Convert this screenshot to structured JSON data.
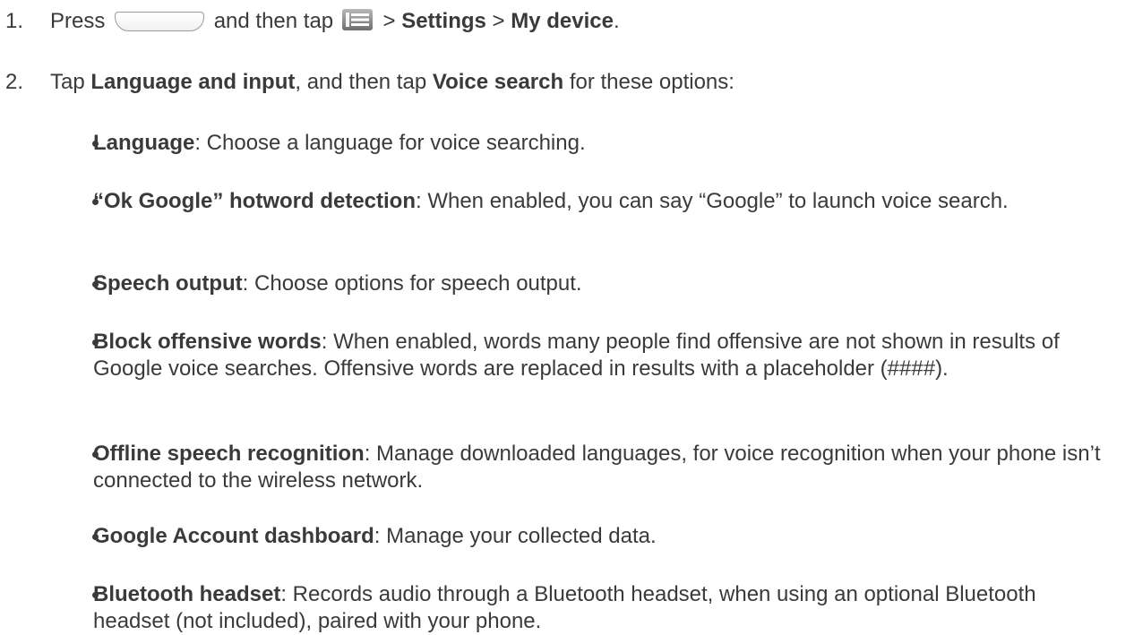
{
  "steps": [
    {
      "number": "1.",
      "text_press": "Press",
      "home_key_icon": "home-key-icon",
      "text_then_tap": "and then tap",
      "menu_key_icon": "menu-key-icon",
      "sep1": ">",
      "settings": "Settings",
      "sep2": ">",
      "my_device": "My device",
      "end": "."
    },
    {
      "number": "2.",
      "text_tap": "Tap",
      "language_and_input": "Language and input",
      "text_mid": ", and then tap",
      "voice_search": "Voice search",
      "text_end": "for these options:"
    }
  ],
  "options": [
    {
      "term": "Language",
      "desc": ": Choose a language for voice searching."
    },
    {
      "term": "“Ok Google” hotword detection",
      "desc": ": When enabled, you can say “Google” to launch voice search."
    },
    {
      "term": "Speech output",
      "desc": ": Choose options for speech output."
    },
    {
      "term": "Block offensive words",
      "desc": ": When enabled, words many people find offensive are not shown in results of Google voice searches. Offensive words are replaced in results with a placeholder (####)."
    },
    {
      "term": "Offline speech recognition",
      "desc": ": Manage downloaded languages, for voice recognition when your phone isn’t connected to the wireless network."
    },
    {
      "term": "Google Account dashboard",
      "desc": ": Manage your collected data."
    },
    {
      "term": "Bluetooth headset",
      "desc": ": Records audio through a Bluetooth headset, when using an optional Bluetooth headset (not included), paired with your phone."
    }
  ]
}
